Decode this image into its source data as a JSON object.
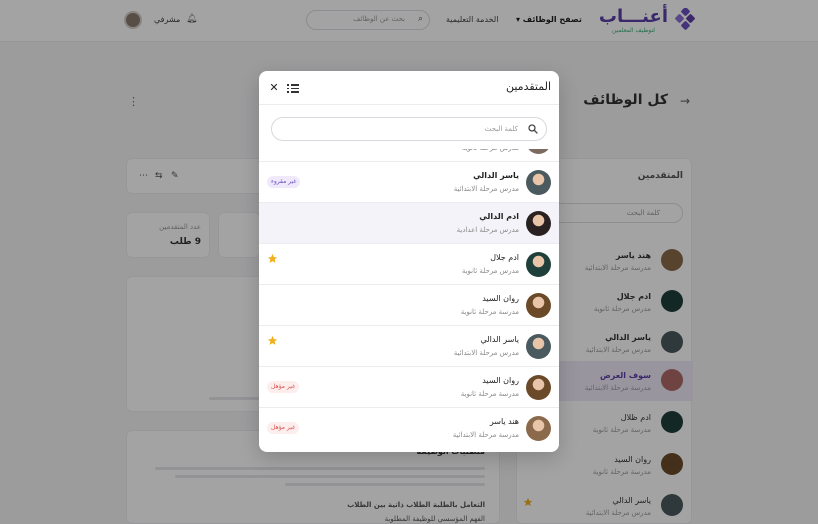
{
  "app": {
    "logo_text": "أعنـــاب",
    "logo_subtitle": "لتوظيف المعلمين",
    "colors": {
      "brand": "#5b3fa8",
      "accent": "#f2b01e",
      "badge_unread": "#6b4fc0",
      "badge_unqualified": "#d9534f"
    }
  },
  "nav": {
    "items": [
      {
        "label": "تصفح الوظائف ▾",
        "active": true
      },
      {
        "label": "الخدمة التعليمية",
        "active": false
      }
    ],
    "search_placeholder": "بحث عن الوظائف",
    "user_name": "مشرفي",
    "bell_icon": "bell-icon"
  },
  "page": {
    "title": "كل الوظائف"
  },
  "background": {
    "panel_title": "المتقدمين",
    "panel_search": "كلمة البحث",
    "applicants": [
      {
        "name": "هند ياسر",
        "job": "مدرسة مرحلة الابتدائية"
      },
      {
        "name": "ادم جلال",
        "job": "مدرس مرحلة ثانوية"
      },
      {
        "name": "ياسر الدالي",
        "job": "مدرس مرحلة الابتدائية"
      },
      {
        "name": "سوف العرض",
        "job": "مدرسة مرحلة الابتدائية"
      },
      {
        "name": "ادم ظلال",
        "job": "مدرسة مرحلة ثانوية"
      },
      {
        "name": "روان السيد",
        "job": "مدرسة مرحلة ثانوية"
      },
      {
        "name": "ياسر الدالي",
        "job": "مدرس مرحلة الابتدائية"
      }
    ],
    "stat_label": "عدد المتقدمين",
    "stat_value": "9 طلب",
    "section_heading": "متطلبات الوظيفة",
    "bullet_1": "التعامل بالطلبة الطلاب ذاتية بين الطلاب",
    "bullet_2": "الفهم المؤسسي للوظيفة المطلوبة"
  },
  "modal": {
    "title": "المتقدمين",
    "close_icon": "close-icon",
    "list_icon": "list-icon",
    "search_placeholder": "كلمة البحث",
    "applicants": [
      {
        "name": "",
        "job": "مدرس مرحلة ثانوية",
        "avatar_color": "#7d6a60",
        "badge": "",
        "badge_type": "",
        "starred": false,
        "selected": false,
        "partial": true
      },
      {
        "name": "ياسر الدالي",
        "job": "مدرس مرحلة الابتدائية",
        "avatar_color": "#4a5a5e",
        "badge": "غير مقروء",
        "badge_type": "unread",
        "starred": false,
        "selected": false,
        "bold": true
      },
      {
        "name": "ادم الدالي",
        "job": "مدرس مرحلة اعدادية",
        "avatar_color": "#2a2220",
        "badge": "",
        "badge_type": "",
        "starred": false,
        "selected": true,
        "bold": true
      },
      {
        "name": "ادم جلال",
        "job": "مدرس مرحلة ثانوية",
        "avatar_color": "#1f3f3a",
        "badge": "",
        "badge_type": "",
        "starred": true,
        "selected": false
      },
      {
        "name": "روان السيد",
        "job": "مدرسة مرحلة ثانوية",
        "avatar_color": "#6b4a2a",
        "badge": "",
        "badge_type": "",
        "starred": false,
        "selected": false
      },
      {
        "name": "ياسر الدالي",
        "job": "مدرس مرحلة الابتدائية",
        "avatar_color": "#4a5a5e",
        "badge": "",
        "badge_type": "",
        "starred": true,
        "selected": false
      },
      {
        "name": "روان السيد",
        "job": "مدرسة مرحلة ثانوية",
        "avatar_color": "#6b4a2a",
        "badge": "غير مؤهل",
        "badge_type": "unqualified",
        "starred": false,
        "selected": false
      },
      {
        "name": "هند ياسر",
        "job": "مدرسة مرحلة الابتدائية",
        "avatar_color": "#8a6a4a",
        "badge": "غير مؤهل",
        "badge_type": "unqualified",
        "starred": false,
        "selected": false
      }
    ]
  }
}
